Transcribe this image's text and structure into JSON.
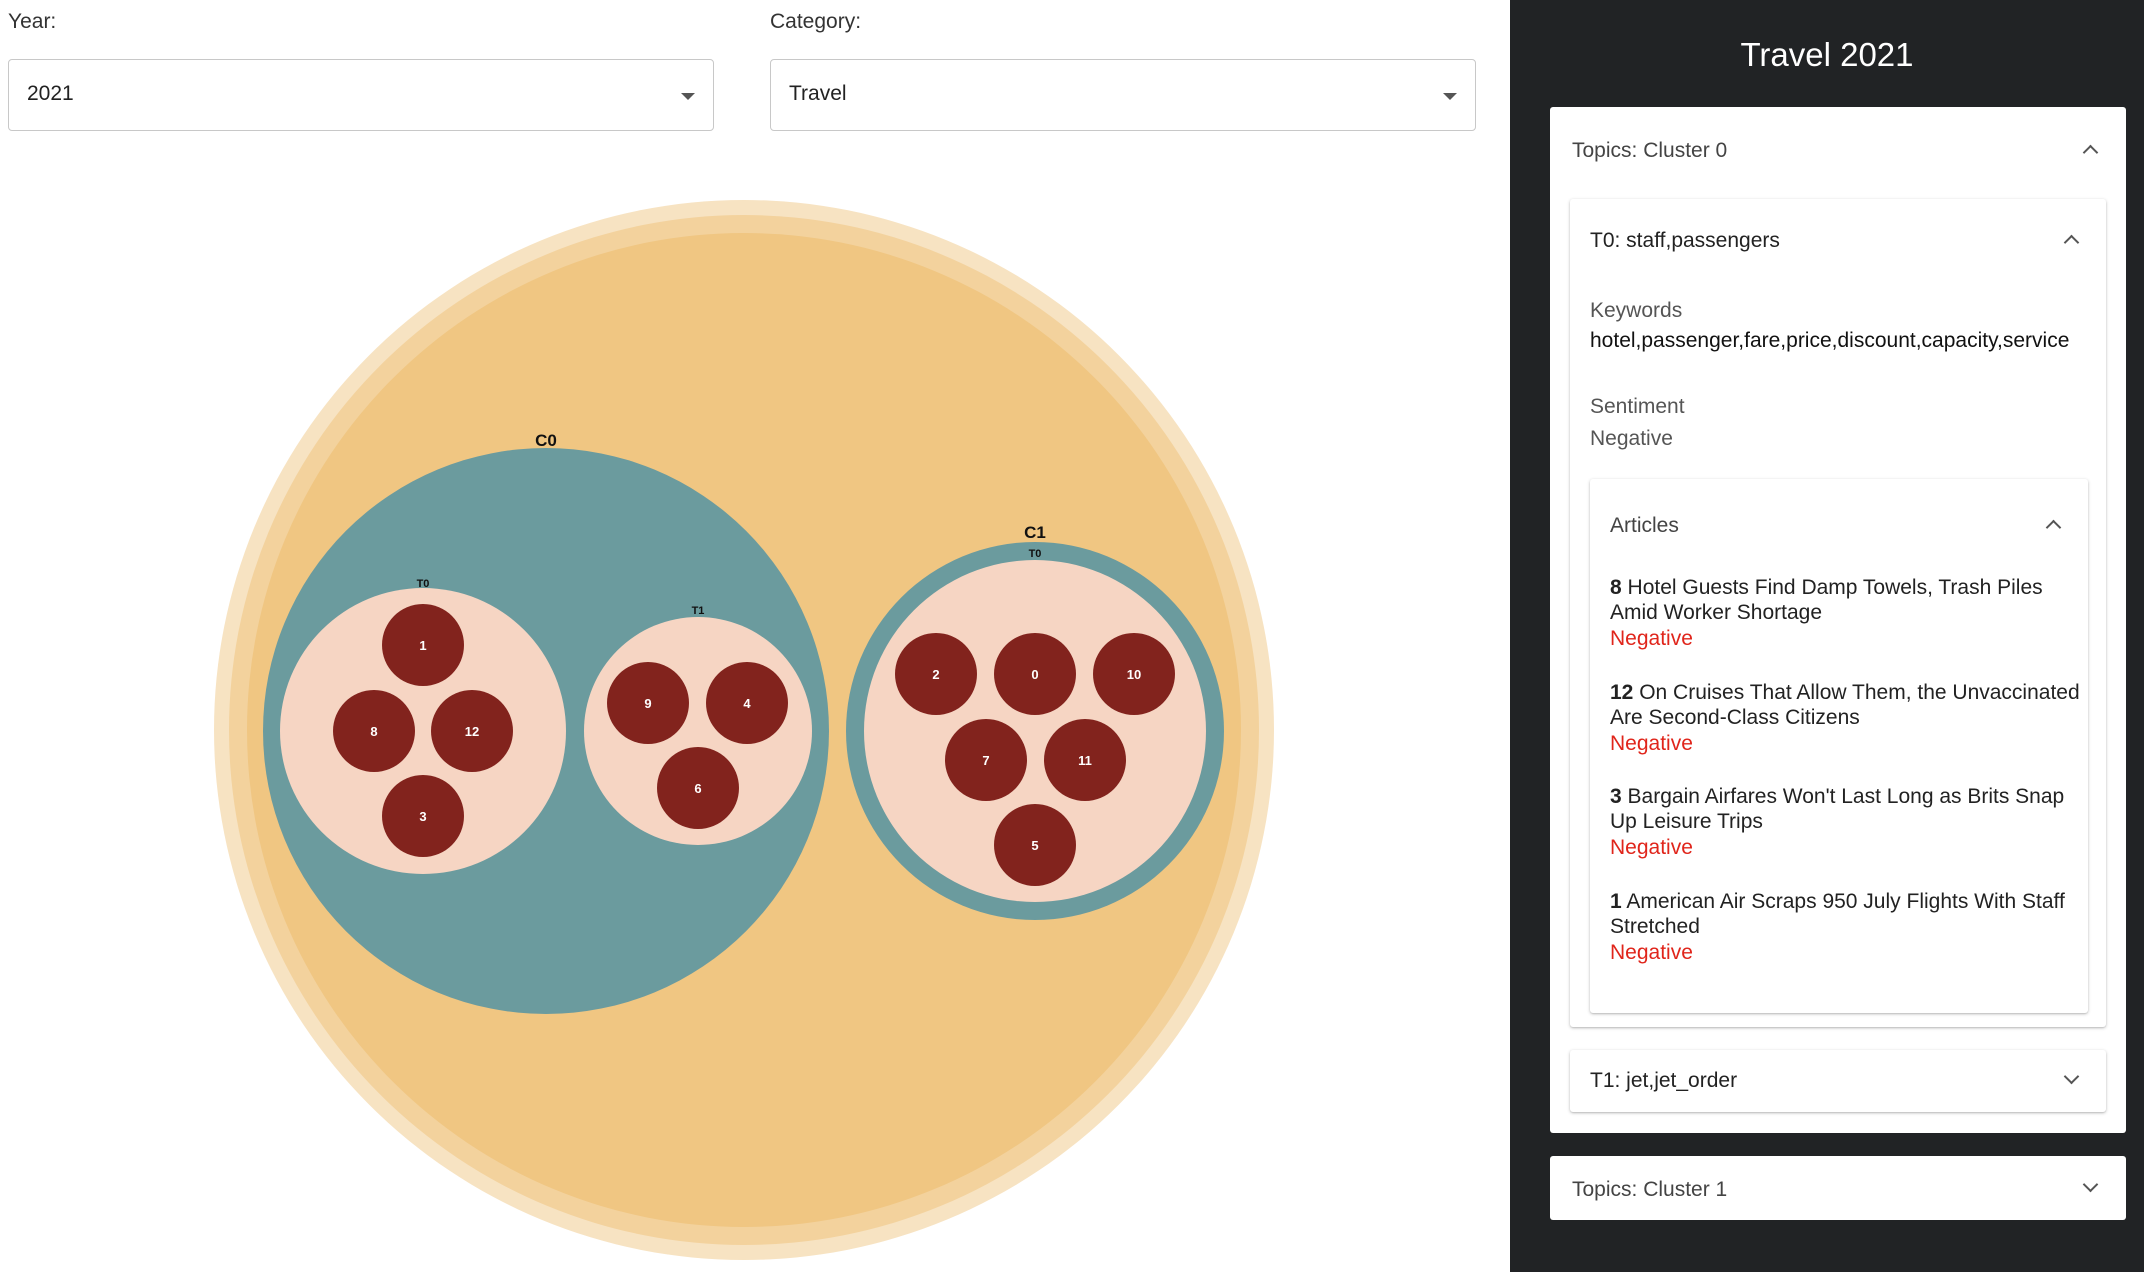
{
  "filters": {
    "year_label": "Year:",
    "year_value": "2021",
    "category_label": "Category:",
    "category_value": "Travel"
  },
  "chart": {
    "colors": {
      "outer_halo": "#f7e3c2",
      "outer_ring": "#f3d29d",
      "outer_fill": "#f0c682",
      "cluster": "#6b9b9e",
      "topic": "#f6d5c3",
      "article": "#82231d",
      "article_text": "#ffffff"
    },
    "clusters": [
      {
        "label": "C0",
        "topics": [
          {
            "label": "T0",
            "articles": [
              "1",
              "8",
              "12",
              "3"
            ]
          },
          {
            "label": "T1",
            "articles": [
              "9",
              "4",
              "6"
            ]
          }
        ]
      },
      {
        "label": "C1",
        "topics": [
          {
            "label": "T0",
            "articles": [
              "2",
              "0",
              "10",
              "7",
              "11",
              "5"
            ]
          }
        ]
      }
    ]
  },
  "sidebar": {
    "title": "Travel 2021",
    "cluster0_header": "Topics: Cluster 0",
    "cluster1_header": "Topics: Cluster 1",
    "topic0_header": "T0: staff,passengers",
    "topic1_header": "T1: jet,jet_order",
    "keywords_label": "Keywords",
    "keywords_value": "hotel,passenger,fare,price,discount,capacity,service",
    "sentiment_label": "Sentiment",
    "sentiment_value": "Negative",
    "articles_header": "Articles",
    "articles": [
      {
        "num": "8",
        "title": "Hotel Guests Find Damp Towels, Trash Piles Amid Worker Shortage",
        "sentiment": "Negative"
      },
      {
        "num": "12",
        "title": "On Cruises That Allow Them, the Unvaccinated Are Second-Class Citizens",
        "sentiment": "Negative"
      },
      {
        "num": "3",
        "title": "Bargain Airfares Won't Last Long as Brits Snap Up Leisure Trips",
        "sentiment": "Negative"
      },
      {
        "num": "1",
        "title": "American Air Scraps 950 July Flights With Staff Stretched",
        "sentiment": "Negative"
      }
    ]
  }
}
